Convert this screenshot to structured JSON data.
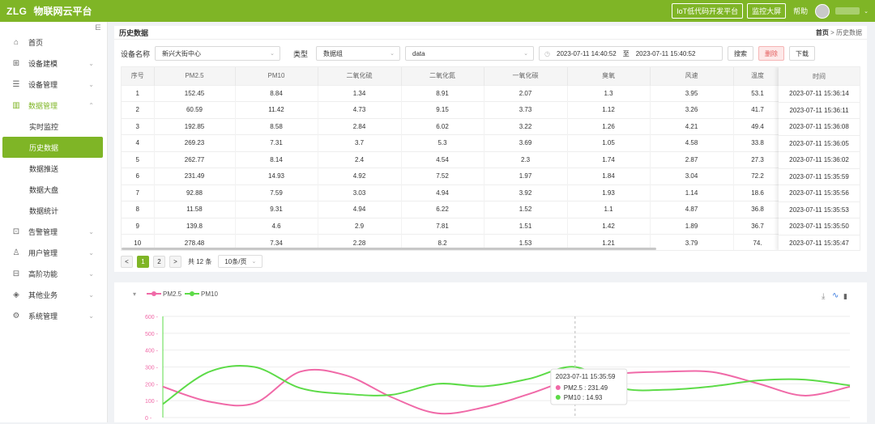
{
  "topbar": {
    "logo": "ZLG",
    "brand": "物联网云平台",
    "btn_iot": "IoT低代码开发平台",
    "btn_screen": "监控大屏",
    "help": "帮助"
  },
  "sidebar": {
    "collapse_icon": "⋿",
    "items": [
      {
        "label": "首页",
        "icon": "home-icon",
        "glyph": "⌂"
      },
      {
        "label": "设备建模",
        "icon": "model-icon",
        "glyph": "⊞"
      },
      {
        "label": "设备管理",
        "icon": "device-icon",
        "glyph": "☰"
      },
      {
        "label": "数据管理",
        "icon": "chart-bars-icon",
        "glyph": "▥"
      }
    ],
    "sub_items": [
      {
        "label": "实时监控"
      },
      {
        "label": "历史数据"
      },
      {
        "label": "数据推送"
      },
      {
        "label": "数据大盘"
      },
      {
        "label": "数据统计"
      }
    ],
    "items2": [
      {
        "label": "告警管理",
        "icon": "alarm-icon",
        "glyph": "⊡"
      },
      {
        "label": "用户管理",
        "icon": "user-icon",
        "glyph": "♙"
      },
      {
        "label": "高阶功能",
        "icon": "advanced-icon",
        "glyph": "⊟"
      },
      {
        "label": "其他业务",
        "icon": "other-icon",
        "glyph": "◈"
      },
      {
        "label": "系统管理",
        "icon": "settings-icon",
        "glyph": "⚙"
      }
    ]
  },
  "header": {
    "title": "历史数据",
    "crumb_home": "首页",
    "crumb_sep": ">",
    "crumb_current": "历史数据"
  },
  "filter": {
    "device_label": "设备名称",
    "device_value": "新兴大街中心",
    "type_label": "类型",
    "type_value": "数据组",
    "data_value": "data",
    "start": "2023-07-11 14:40:52",
    "to": "至",
    "end": "2023-07-11 15:40:52",
    "search": "搜索",
    "delete": "删除",
    "download": "下载"
  },
  "table": {
    "headers": [
      "序号",
      "PM2.5",
      "PM10",
      "二氧化硫",
      "二氧化氮",
      "一氧化碳",
      "臭氧",
      "风速",
      "温度"
    ],
    "time_header": "时间",
    "rows": [
      [
        "1",
        "152.45",
        "8.84",
        "1.34",
        "8.91",
        "2.07",
        "1.3",
        "3.95",
        "53.1",
        "2023-07-11 15:36:14"
      ],
      [
        "2",
        "60.59",
        "11.42",
        "4.73",
        "9.15",
        "3.73",
        "1.12",
        "3.26",
        "41.7",
        "2023-07-11 15:36:11"
      ],
      [
        "3",
        "192.85",
        "8.58",
        "2.84",
        "6.02",
        "3.22",
        "1.26",
        "4.21",
        "49.4",
        "2023-07-11 15:36:08"
      ],
      [
        "4",
        "269.23",
        "7.31",
        "3.7",
        "5.3",
        "3.69",
        "1.05",
        "4.58",
        "33.8",
        "2023-07-11 15:36:05"
      ],
      [
        "5",
        "262.77",
        "8.14",
        "2.4",
        "4.54",
        "2.3",
        "1.74",
        "2.87",
        "27.3",
        "2023-07-11 15:36:02"
      ],
      [
        "6",
        "231.49",
        "14.93",
        "4.92",
        "7.52",
        "1.97",
        "1.84",
        "3.04",
        "72.2",
        "2023-07-11 15:35:59"
      ],
      [
        "7",
        "92.88",
        "7.59",
        "3.03",
        "4.94",
        "3.92",
        "1.93",
        "1.14",
        "18.6",
        "2023-07-11 15:35:56"
      ],
      [
        "8",
        "11.58",
        "9.31",
        "4.94",
        "6.22",
        "1.52",
        "1.1",
        "4.87",
        "36.8",
        "2023-07-11 15:35:53"
      ],
      [
        "9",
        "139.8",
        "4.6",
        "2.9",
        "7.81",
        "1.51",
        "1.42",
        "1.89",
        "36.7",
        "2023-07-11 15:35:50"
      ],
      [
        "10",
        "278.48",
        "7.34",
        "2.28",
        "8.2",
        "1.53",
        "1.21",
        "3.79",
        "74.",
        "2023-07-11 15:35:47"
      ]
    ]
  },
  "pager": {
    "prev": "<",
    "next": ">",
    "pages": [
      "1",
      "2"
    ],
    "total": "共 12 条",
    "size": "10条/页"
  },
  "chart_data": {
    "type": "line",
    "series": [
      {
        "name": "PM2.5",
        "color": "#f06aa8",
        "values": [
          183,
          95,
          85,
          272,
          250,
          120,
          25,
          60,
          140,
          231.49,
          262,
          272,
          270,
          201,
          130,
          183
        ]
      },
      {
        "name": "PM10",
        "color": "#5ddb48",
        "values": [
          80,
          270,
          300,
          175,
          140,
          135,
          200,
          185,
          230,
          300,
          175,
          165,
          185,
          220,
          225,
          190
        ]
      }
    ],
    "ylim": [
      0,
      600
    ],
    "yticks": [
      "600",
      "500",
      "400",
      "300",
      "200",
      "100",
      "0"
    ],
    "tooltip": {
      "time": "2023-07-11 15:35:59",
      "pm25": "PM2.5 : 231.49",
      "pm10": "PM10 : 14.93"
    }
  }
}
